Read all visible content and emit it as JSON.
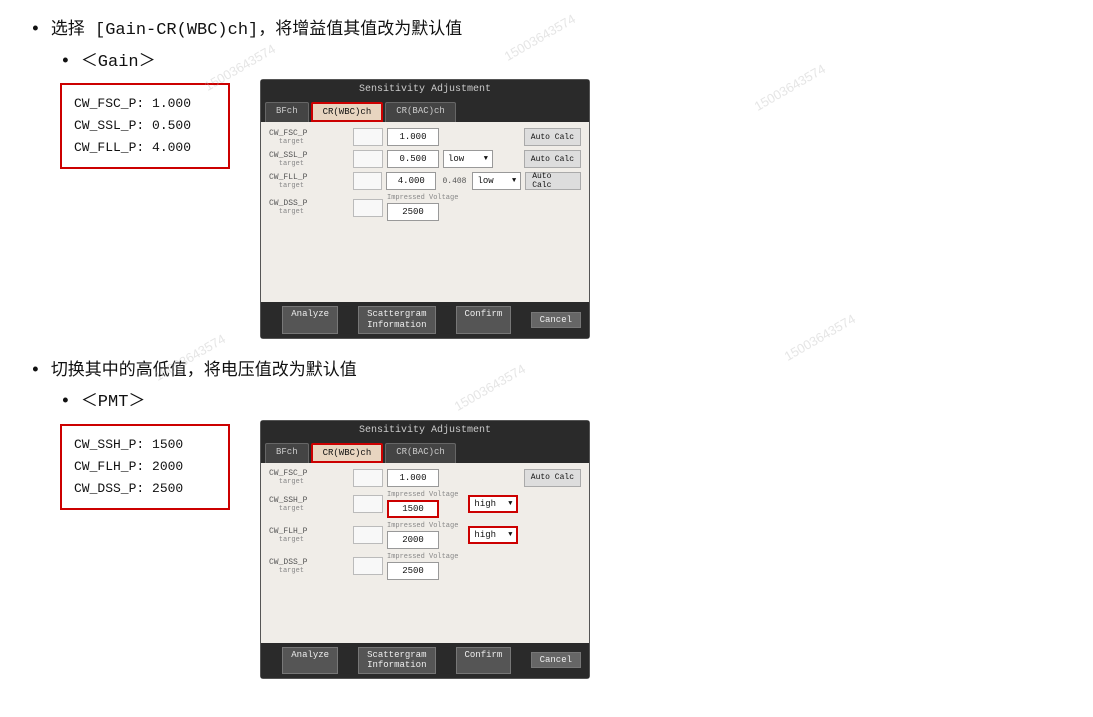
{
  "watermarks": [
    "15003643574",
    "15003643574",
    "15003643574",
    "15003643574",
    "15003643574",
    "15003643574"
  ],
  "section1": {
    "bullet1": "选择 [Gain-CR(WBC)ch]，将增益值其值改为默认值",
    "bullet2": "＜Gain＞",
    "infobox": {
      "line1": "CW_FSC_P: 1.000",
      "line2": "CW_SSL_P: 0.500",
      "line3": "CW_FLL_P: 4.000"
    },
    "dialog": {
      "title": "Sensitivity Adjustment",
      "tabs": [
        "BFch",
        "CR(WBC)ch",
        "CR(BAC)ch"
      ],
      "activeTab": 1,
      "rows": [
        {
          "label": "CW_FSC_P",
          "sublabel": "target",
          "value": "1.000",
          "highlighted": false,
          "hasDropdown": false,
          "hasSmallValue": false,
          "hasAutoCalc": true
        },
        {
          "label": "CW_SSL_P",
          "sublabel": "target",
          "value": "0.500",
          "highlighted": false,
          "hasDropdown": true,
          "dropdownVal": "low",
          "dropdownHighlighted": false,
          "hasAutoCalc": true
        },
        {
          "label": "CW_FLL_P",
          "sublabel": "target",
          "value": "4.000",
          "smallValue": "0.408",
          "highlighted": false,
          "hasDropdown": true,
          "dropdownVal": "low",
          "dropdownHighlighted": false,
          "hasAutoCalc": true
        },
        {
          "label": "CW_DSS_P",
          "sublabel": "target",
          "hasImpressedVoltage": true,
          "impressedValue": "2500",
          "highlighted": false
        }
      ],
      "footer": {
        "analyze": "Analyze",
        "scattergram": "Scattergram\nInformation",
        "confirm": "Confirm",
        "cancel": "Cancel"
      }
    }
  },
  "section2": {
    "bullet1": "切换其中的高低值，将电压值改为默认值",
    "bullet2": "＜PMT＞",
    "infobox": {
      "line1": "CW_SSH_P: 1500",
      "line2": "CW_FLH_P: 2000",
      "line3": "CW_DSS_P: 2500"
    },
    "dialog": {
      "title": "Sensitivity Adjustment",
      "tabs": [
        "BFch",
        "CR(WBC)ch",
        "CR(BAC)ch"
      ],
      "activeTab": 1,
      "rows": [
        {
          "label": "CW_FSC_P",
          "sublabel": "target",
          "value": "1.000",
          "highlighted": false,
          "hasDropdown": false,
          "hasAutoCalc": true
        },
        {
          "label": "CW_SSH_P",
          "sublabel": "target",
          "hasImpressedVoltage": true,
          "impressedValue": "1500",
          "highlighted": true,
          "hasDropdown": true,
          "dropdownVal": "high",
          "dropdownHighlighted": true
        },
        {
          "label": "CW_FLH_P",
          "sublabel": "target",
          "hasImpressedVoltage": true,
          "impressedValue": "2000",
          "highlighted": false,
          "hasDropdown": true,
          "dropdownVal": "high",
          "dropdownHighlighted": true
        },
        {
          "label": "CW_DSS_P",
          "sublabel": "target",
          "hasImpressedVoltage": true,
          "impressedValue": "2500",
          "highlighted": false
        }
      ],
      "footer": {
        "analyze": "Analyze",
        "scattergram": "Scattergram\nInformation",
        "confirm": "Confirm",
        "cancel": "Cancel"
      }
    }
  }
}
